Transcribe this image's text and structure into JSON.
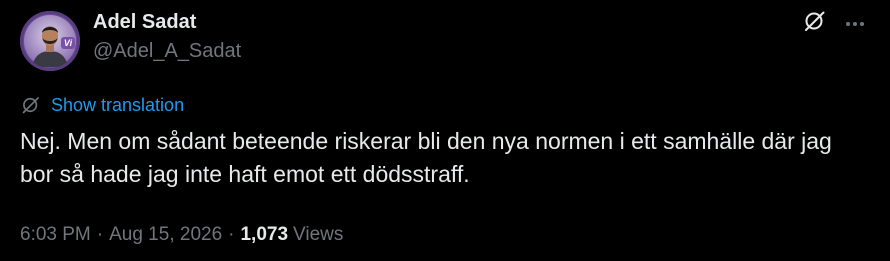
{
  "author": {
    "display_name": "Adel Sadat",
    "handle": "@Adel_A_Sadat",
    "avatar_badge": "Vi"
  },
  "actions": {
    "grok_icon": "grok-icon",
    "more_icon": "more-horizontal-icon"
  },
  "translation": {
    "label": "Show translation"
  },
  "tweet": {
    "text": "Nej. Men om sådant beteende riskerar bli den nya normen i ett samhälle där jag bor så hade jag inte haft emot ett dödsstraff."
  },
  "meta": {
    "time": "6:03 PM",
    "separator": "·",
    "date": "Aug 15, 2026",
    "views_count": "1,073",
    "views_label": "Views"
  },
  "colors": {
    "background": "#000000",
    "primary_text": "#e7e9ea",
    "secondary_text": "#71767b",
    "accent": "#1d9bf0",
    "avatar_ring": "#6a4c93"
  }
}
